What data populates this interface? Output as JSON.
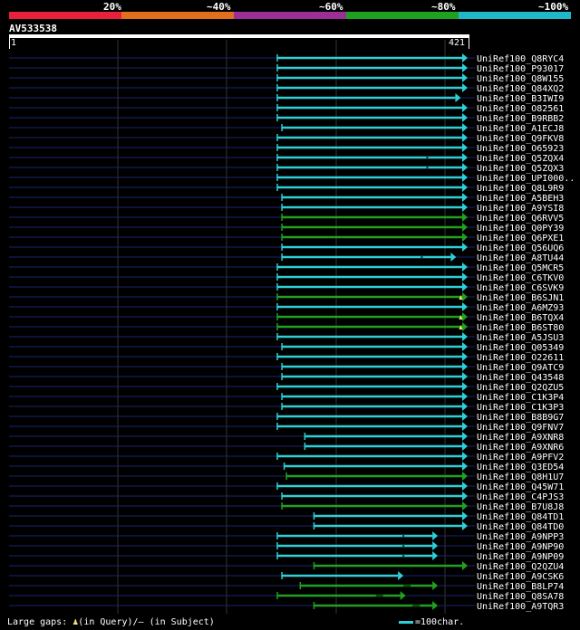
{
  "legend": {
    "percent_labels": [
      "20%",
      "~40%",
      "~60%",
      "~80%",
      "~100%"
    ],
    "colors": [
      "#e8203a",
      "#e0701c",
      "#9b2f95",
      "#20a020",
      "#20b8c8"
    ]
  },
  "query": {
    "name": "AV533538",
    "start": "1",
    "end": "421"
  },
  "hits": [
    {
      "name": "UniRef100_Q8RYC4",
      "s": 0.585,
      "e": 1.0,
      "color": "cyan",
      "arrow": true
    },
    {
      "name": "UniRef100_P93017",
      "s": 0.585,
      "e": 1.0,
      "color": "cyan",
      "arrow": true
    },
    {
      "name": "UniRef100_Q8W155",
      "s": 0.585,
      "e": 1.0,
      "color": "cyan",
      "arrow": true
    },
    {
      "name": "UniRef100_Q84XQ2",
      "s": 0.585,
      "e": 1.0,
      "color": "cyan",
      "arrow": true
    },
    {
      "name": "UniRef100_B3IWI9",
      "s": 0.585,
      "e": 0.985,
      "color": "cyan",
      "arrow": true
    },
    {
      "name": "UniRef100_O82561",
      "s": 0.585,
      "e": 1.0,
      "color": "cyan",
      "arrow": true
    },
    {
      "name": "UniRef100_B9RBB2",
      "s": 0.585,
      "e": 1.0,
      "color": "cyan",
      "arrow": true
    },
    {
      "name": "UniRef100_A1ECJ8",
      "s": 0.595,
      "e": 1.0,
      "color": "cyan",
      "arrow": true
    },
    {
      "name": "UniRef100_Q9FKV8",
      "s": 0.585,
      "e": 1.0,
      "color": "cyan",
      "arrow": true
    },
    {
      "name": "UniRef100_O65923",
      "s": 0.585,
      "e": 1.0,
      "color": "cyan",
      "arrow": true
    },
    {
      "name": "UniRef100_Q5ZQX4",
      "s": 0.585,
      "e": 1.0,
      "color": "cyan",
      "arrow": true,
      "gap": 0.912
    },
    {
      "name": "UniRef100_Q5ZQX3",
      "s": 0.585,
      "e": 1.0,
      "color": "cyan",
      "arrow": true,
      "gap": 0.912
    },
    {
      "name": "UniRef100_UPI000..",
      "s": 0.585,
      "e": 1.0,
      "color": "cyan",
      "arrow": true
    },
    {
      "name": "UniRef100_Q8L9R9",
      "s": 0.585,
      "e": 1.0,
      "color": "cyan",
      "arrow": true
    },
    {
      "name": "UniRef100_A5BEH3",
      "s": 0.595,
      "e": 1.0,
      "color": "cyan",
      "arrow": true
    },
    {
      "name": "UniRef100_A9YSI8",
      "s": 0.595,
      "e": 1.0,
      "color": "cyan",
      "arrow": true
    },
    {
      "name": "UniRef100_Q6RVV5",
      "s": 0.595,
      "e": 1.0,
      "color": "green",
      "arrow": true
    },
    {
      "name": "UniRef100_Q0PY39",
      "s": 0.595,
      "e": 1.0,
      "color": "green",
      "arrow": true
    },
    {
      "name": "UniRef100_Q6PXE1",
      "s": 0.595,
      "e": 1.0,
      "color": "green",
      "arrow": true
    },
    {
      "name": "UniRef100_Q56UQ6",
      "s": 0.595,
      "e": 1.0,
      "color": "cyan",
      "arrow": true
    },
    {
      "name": "UniRef100_A8TU44",
      "s": 0.595,
      "e": 0.975,
      "color": "cyan",
      "arrow": true,
      "gap": 0.9
    },
    {
      "name": "UniRef100_Q5MCR5",
      "s": 0.585,
      "e": 1.0,
      "color": "cyan",
      "arrow": true
    },
    {
      "name": "UniRef100_C6TKV0",
      "s": 0.585,
      "e": 1.0,
      "color": "cyan",
      "arrow": true
    },
    {
      "name": "UniRef100_C6SVK9",
      "s": 0.585,
      "e": 1.0,
      "color": "cyan",
      "arrow": true
    },
    {
      "name": "UniRef100_B6SJN1",
      "s": 0.585,
      "e": 1.0,
      "color": "green",
      "arrow": true,
      "marker": 0.985
    },
    {
      "name": "UniRef100_A6MZ93",
      "s": 0.585,
      "e": 1.0,
      "color": "cyan",
      "arrow": true
    },
    {
      "name": "UniRef100_B6TQX4",
      "s": 0.585,
      "e": 1.0,
      "color": "green",
      "arrow": true,
      "marker": 0.985
    },
    {
      "name": "UniRef100_B6ST80",
      "s": 0.585,
      "e": 1.0,
      "color": "green",
      "arrow": true,
      "marker": 0.985
    },
    {
      "name": "UniRef100_A5JSU3",
      "s": 0.585,
      "e": 1.0,
      "color": "cyan",
      "arrow": true
    },
    {
      "name": "UniRef100_Q05349",
      "s": 0.595,
      "e": 1.0,
      "color": "cyan",
      "arrow": true
    },
    {
      "name": "UniRef100_O22611",
      "s": 0.585,
      "e": 1.0,
      "color": "cyan",
      "arrow": true
    },
    {
      "name": "UniRef100_Q9ATC9",
      "s": 0.595,
      "e": 1.0,
      "color": "cyan",
      "arrow": true
    },
    {
      "name": "UniRef100_Q43548",
      "s": 0.595,
      "e": 1.0,
      "color": "cyan",
      "arrow": true
    },
    {
      "name": "UniRef100_Q2QZU5",
      "s": 0.585,
      "e": 1.0,
      "color": "cyan",
      "arrow": true
    },
    {
      "name": "UniRef100_C1K3P4",
      "s": 0.595,
      "e": 1.0,
      "color": "cyan",
      "arrow": true
    },
    {
      "name": "UniRef100_C1K3P3",
      "s": 0.595,
      "e": 1.0,
      "color": "cyan",
      "arrow": true
    },
    {
      "name": "UniRef100_B8B9G7",
      "s": 0.585,
      "e": 1.0,
      "color": "cyan",
      "arrow": true
    },
    {
      "name": "UniRef100_Q9FNV7",
      "s": 0.585,
      "e": 1.0,
      "color": "cyan",
      "arrow": true
    },
    {
      "name": "UniRef100_A9XNR8",
      "s": 0.645,
      "e": 1.0,
      "color": "cyan",
      "arrow": true
    },
    {
      "name": "UniRef100_A9XNR6",
      "s": 0.645,
      "e": 1.0,
      "color": "cyan",
      "arrow": true
    },
    {
      "name": "UniRef100_A9PFV2",
      "s": 0.585,
      "e": 1.0,
      "color": "cyan",
      "arrow": true
    },
    {
      "name": "UniRef100_Q3ED54",
      "s": 0.6,
      "e": 1.0,
      "color": "cyan",
      "arrow": true
    },
    {
      "name": "UniRef100_Q8H1U7",
      "s": 0.605,
      "e": 1.0,
      "color": "green",
      "arrow": true
    },
    {
      "name": "UniRef100_Q45W71",
      "s": 0.585,
      "e": 1.0,
      "color": "cyan",
      "arrow": true
    },
    {
      "name": "UniRef100_C4PJS3",
      "s": 0.595,
      "e": 1.0,
      "color": "cyan",
      "arrow": true
    },
    {
      "name": "UniRef100_B7U8J8",
      "s": 0.595,
      "e": 1.0,
      "color": "green",
      "arrow": true
    },
    {
      "name": "UniRef100_Q84TD1",
      "s": 0.665,
      "e": 1.0,
      "color": "cyan",
      "arrow": true
    },
    {
      "name": "UniRef100_Q84TD0",
      "s": 0.665,
      "e": 1.0,
      "color": "cyan",
      "arrow": true
    },
    {
      "name": "UniRef100_A9NPP3",
      "s": 0.585,
      "e": 0.935,
      "color": "cyan",
      "arrow": true,
      "gap": 0.86
    },
    {
      "name": "UniRef100_A9NP90",
      "s": 0.585,
      "e": 0.935,
      "color": "cyan",
      "arrow": true,
      "gap": 0.86
    },
    {
      "name": "UniRef100_A9NP09",
      "s": 0.585,
      "e": 0.935,
      "color": "cyan",
      "arrow": true,
      "gap": 0.86
    },
    {
      "name": "UniRef100_Q2QZU4",
      "s": 0.665,
      "e": 1.0,
      "color": "green",
      "arrow": true
    },
    {
      "name": "UniRef100_A9CSK6",
      "s": 0.595,
      "e": 0.86,
      "color": "cyan",
      "arrow": true
    },
    {
      "name": "UniRef100_B8LP74",
      "s": 0.635,
      "e": 0.935,
      "color": "green",
      "arrow": true,
      "dash": 0.86
    },
    {
      "name": "UniRef100_Q8SA78",
      "s": 0.585,
      "e": 0.865,
      "color": "green",
      "arrow": true,
      "dash": 0.8
    },
    {
      "name": "UniRef100_A9TQR3",
      "s": 0.665,
      "e": 0.935,
      "color": "green",
      "arrow": true,
      "dash": 0.88
    }
  ],
  "footer": {
    "gaps_label": "Large gaps:",
    "query_gap": "(in Query)/",
    "subject_gap": "– (in Subject)",
    "gap_glyph": "♟",
    "scale_label": "=100char."
  }
}
